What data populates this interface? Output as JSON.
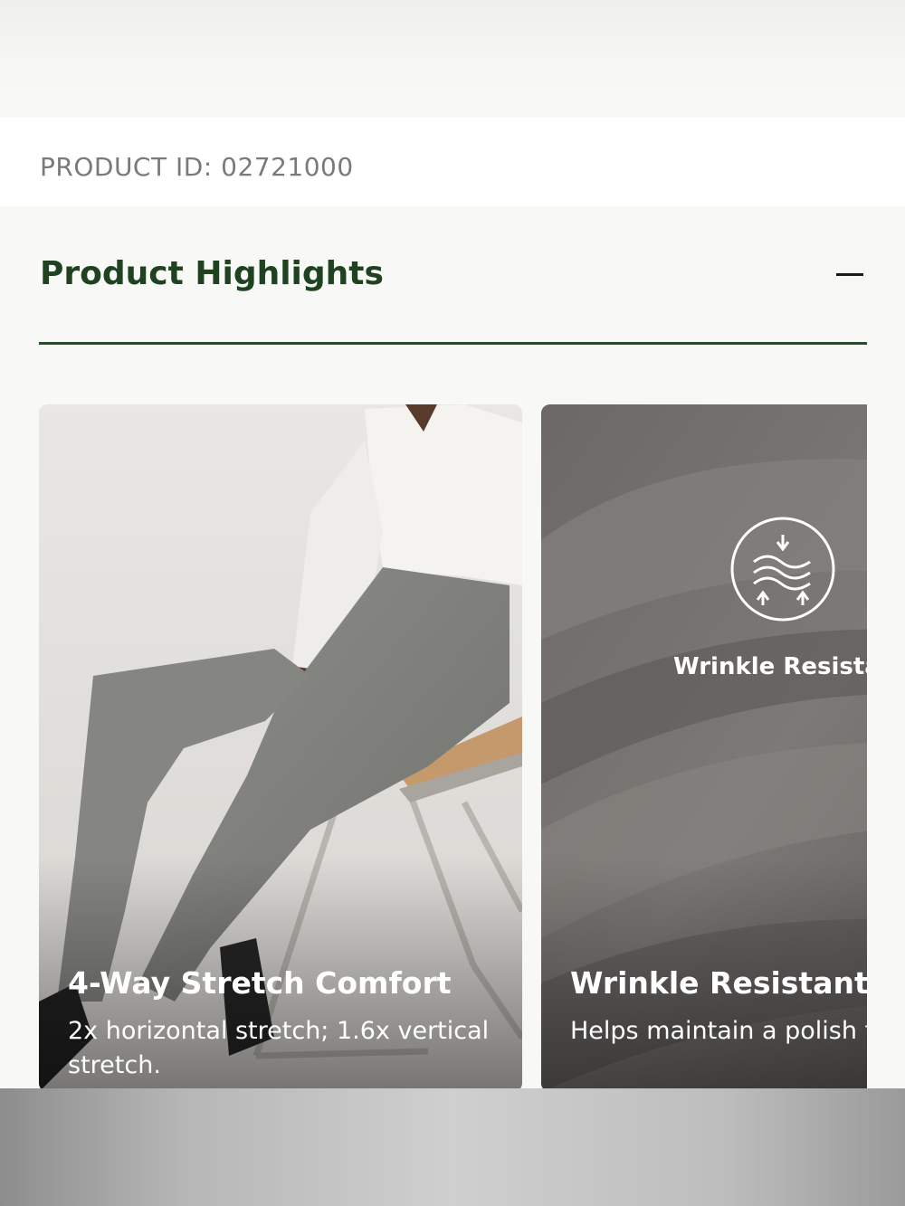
{
  "product": {
    "id_text": "PRODUCT ID: 02721000"
  },
  "highlights": {
    "title": "Product Highlights",
    "toggle_icon": "minus-icon",
    "accent_color": "#1f4221",
    "cards": [
      {
        "title": "4-Way Stretch Comfort",
        "description": "2x horizontal stretch; 1.6x vertical stretch.",
        "image": "model-in-grey-trousers-seated-on-chair"
      },
      {
        "title": "Wrinkle Resistant",
        "description": "Helps maintain a polish through long hours of w",
        "image": "grey-fabric-closeup",
        "badge_label": "Wrinkle Resista",
        "badge_icon": "wrinkle-resistant-icon"
      }
    ]
  }
}
